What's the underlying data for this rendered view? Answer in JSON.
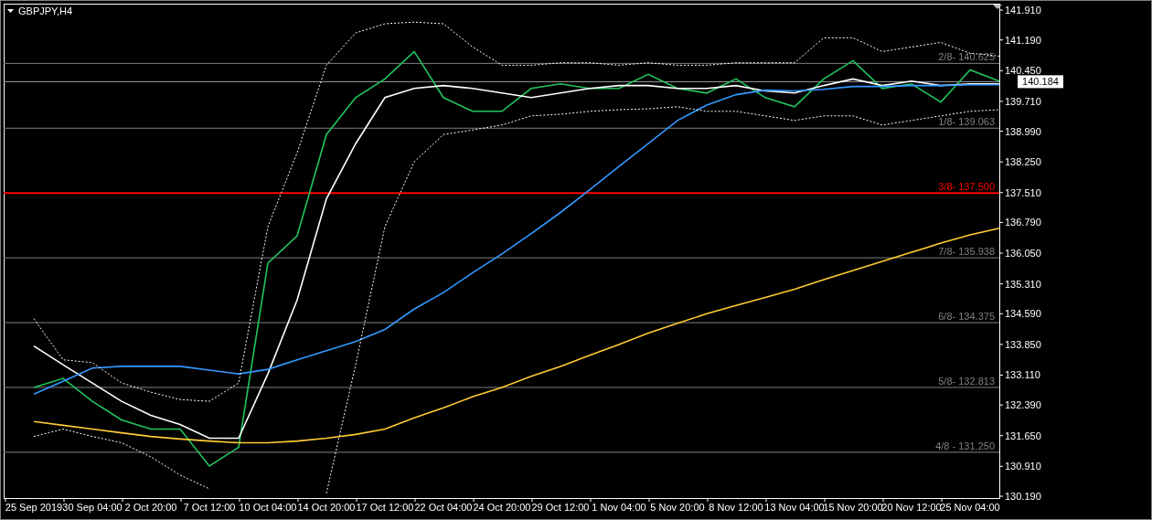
{
  "chart": {
    "title": "GBPJPY,H4",
    "level_tags": [
      "2/8-",
      "1/8-",
      "3/8-",
      "7/8-",
      "6/8-",
      "5/8-",
      "4/8 -"
    ],
    "chart_data": {
      "type": "line",
      "categories": [
        "25 Sep 2019",
        null,
        "30 Sep 04:00",
        null,
        "2 Oct 20:00",
        null,
        "7 Oct 12:00",
        null,
        "10 Oct 04:00",
        null,
        "14 Oct 20:00",
        null,
        "17 Oct 12:00",
        null,
        "22 Oct 04:00",
        null,
        "24 Oct 20:00",
        null,
        "29 Oct 12:00",
        null,
        "1 Nov 04:00",
        null,
        "5 Nov 20:00",
        null,
        "8 Nov 12:00",
        null,
        "13 Nov 04:00",
        null,
        "15 Nov 20:00",
        null,
        "20 Nov 12:00",
        null,
        "25 Nov 04:00",
        null
      ],
      "ylim": [
        130.146,
        142.065
      ],
      "series": [
        {
          "color": "#22c55e",
          "line_style": "solid",
          "values": [
            132.81,
            133.03,
            132.48,
            132.03,
            131.81,
            131.81,
            130.92,
            131.37,
            135.81,
            136.47,
            138.91,
            139.8,
            140.25,
            140.91,
            139.8,
            139.47,
            139.47,
            140.02,
            140.13,
            140.02,
            140.02,
            140.36,
            140.02,
            139.91,
            140.25,
            139.8,
            139.58,
            140.25,
            140.69,
            140.02,
            140.13,
            139.69,
            140.47,
            140.2
          ]
        },
        {
          "color": "#ffffff",
          "line_style": "solid",
          "values": [
            133.81,
            133.36,
            132.92,
            132.48,
            132.14,
            131.92,
            131.59,
            131.59,
            133.14,
            134.92,
            137.36,
            138.69,
            139.8,
            140.02,
            140.09,
            140.02,
            139.91,
            139.8,
            139.91,
            140.02,
            140.09,
            140.09,
            140.02,
            140.02,
            140.09,
            139.96,
            139.91,
            140.09,
            140.25,
            140.09,
            140.2,
            140.09,
            140.13,
            140.13
          ]
        },
        {
          "color": "#3399ff",
          "line_style": "solid",
          "values": [
            132.65,
            132.96,
            133.28,
            133.32,
            133.32,
            133.32,
            133.23,
            133.14,
            133.25,
            133.48,
            133.7,
            133.92,
            134.21,
            134.7,
            135.1,
            135.58,
            136.03,
            136.52,
            137.03,
            137.58,
            138.14,
            138.69,
            139.25,
            139.62,
            139.87,
            139.98,
            139.96,
            140.0,
            140.07,
            140.07,
            140.09,
            140.09,
            140.11,
            140.11
          ]
        },
        {
          "color": "#ffcc33",
          "line_style": "solid",
          "values": [
            131.99,
            131.9,
            131.81,
            131.72,
            131.63,
            131.57,
            131.52,
            131.48,
            131.48,
            131.52,
            131.59,
            131.68,
            131.81,
            132.08,
            132.32,
            132.59,
            132.81,
            133.08,
            133.32,
            133.59,
            133.85,
            134.12,
            134.36,
            134.59,
            134.79,
            134.98,
            135.18,
            135.41,
            135.63,
            135.85,
            136.07,
            136.29,
            136.49,
            136.65
          ]
        },
        {
          "color": "#ffffff",
          "line_style": "dashed",
          "values": [
            134.47,
            133.48,
            133.41,
            132.92,
            132.7,
            132.52,
            132.48,
            132.92,
            136.69,
            138.47,
            140.58,
            141.36,
            141.58,
            141.62,
            141.58,
            141.02,
            140.58,
            140.58,
            140.64,
            140.64,
            140.58,
            140.64,
            140.58,
            140.58,
            140.64,
            140.64,
            140.64,
            141.24,
            141.24,
            140.91,
            141.02,
            141.13,
            140.87,
            140.8
          ]
        },
        {
          "color": "#ffffff",
          "line_style": "dashed",
          "values": [
            131.63,
            131.81,
            131.63,
            131.48,
            131.14,
            130.7,
            130.37,
            null,
            null,
            null,
            130.26,
            133.36,
            136.69,
            138.25,
            138.91,
            139.02,
            139.14,
            139.36,
            139.4,
            139.47,
            139.51,
            139.53,
            139.58,
            139.47,
            139.47,
            139.36,
            139.25,
            139.36,
            139.36,
            139.14,
            139.25,
            139.36,
            139.47,
            139.51
          ]
        }
      ],
      "yticks": [
        {
          "value": 141.91,
          "label": "141.910"
        },
        {
          "value": 141.19,
          "label": "141.190"
        },
        {
          "value": 140.45,
          "label": "140.450"
        },
        {
          "value": 139.71,
          "label": "139.710"
        },
        {
          "value": 138.99,
          "label": "138.990"
        },
        {
          "value": 138.25,
          "label": "138.250"
        },
        {
          "value": 137.51,
          "label": "137.510"
        },
        {
          "value": 136.79,
          "label": "136.790"
        },
        {
          "value": 136.05,
          "label": "136.050"
        },
        {
          "value": 135.31,
          "label": "135.310"
        },
        {
          "value": 134.59,
          "label": "134.590"
        },
        {
          "value": 133.85,
          "label": "133.850"
        },
        {
          "value": 133.11,
          "label": "133.110"
        },
        {
          "value": 132.39,
          "label": "132.390"
        },
        {
          "value": 131.65,
          "label": "131.650"
        },
        {
          "value": 130.91,
          "label": "130.910"
        },
        {
          "value": 130.19,
          "label": "130.190"
        }
      ],
      "ref_lines": [
        {
          "axis": "y",
          "value": 140.625,
          "label": "140.625",
          "color": "#808080"
        },
        {
          "axis": "y",
          "value": 139.063,
          "label": "139.063",
          "color": "#808080"
        },
        {
          "axis": "y",
          "value": 137.5,
          "label": "137.500",
          "color": "#ff0000"
        },
        {
          "axis": "y",
          "value": 135.938,
          "label": "135.938",
          "color": "#808080"
        },
        {
          "axis": "y",
          "value": 134.375,
          "label": "134.375",
          "color": "#808080"
        },
        {
          "axis": "y",
          "value": 132.813,
          "label": "132.813",
          "color": "#808080"
        },
        {
          "axis": "y",
          "value": 131.25,
          "label": "131.250",
          "color": "#808080"
        },
        {
          "axis": "y",
          "value": 140.184,
          "label": "140.184",
          "color": "#a0a0a0"
        }
      ]
    }
  }
}
